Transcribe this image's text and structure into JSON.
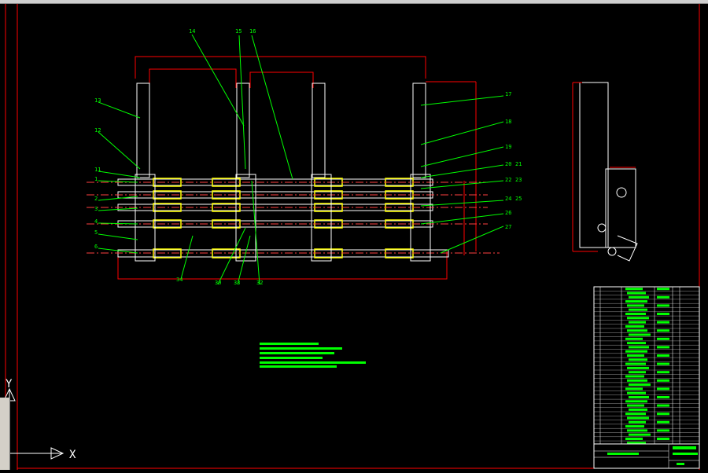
{
  "app": {
    "name": "CAD drawing viewport"
  },
  "colors": {
    "background": "#000000",
    "frame": "#ff0000",
    "leader": "#00ff00",
    "hatch": "#ffff00",
    "part": "#ffffff",
    "title_fill": "#00ff00"
  },
  "ucs": {
    "x_label": "X",
    "y_label": "Y"
  },
  "callouts": {
    "top": [
      "14",
      "15",
      "16"
    ],
    "left": [
      "13",
      "12",
      "11",
      "1",
      "2",
      "3",
      "4",
      "5",
      "6"
    ],
    "right": [
      "17",
      "18",
      "19",
      "20",
      "21",
      "22",
      "23",
      "24",
      "25",
      "26",
      "27"
    ],
    "bottom": [
      "34",
      "30",
      "33",
      "32"
    ]
  },
  "icons": {
    "ucs": "ucs-axis-icon",
    "tray": "toolbar-tray-icon"
  }
}
